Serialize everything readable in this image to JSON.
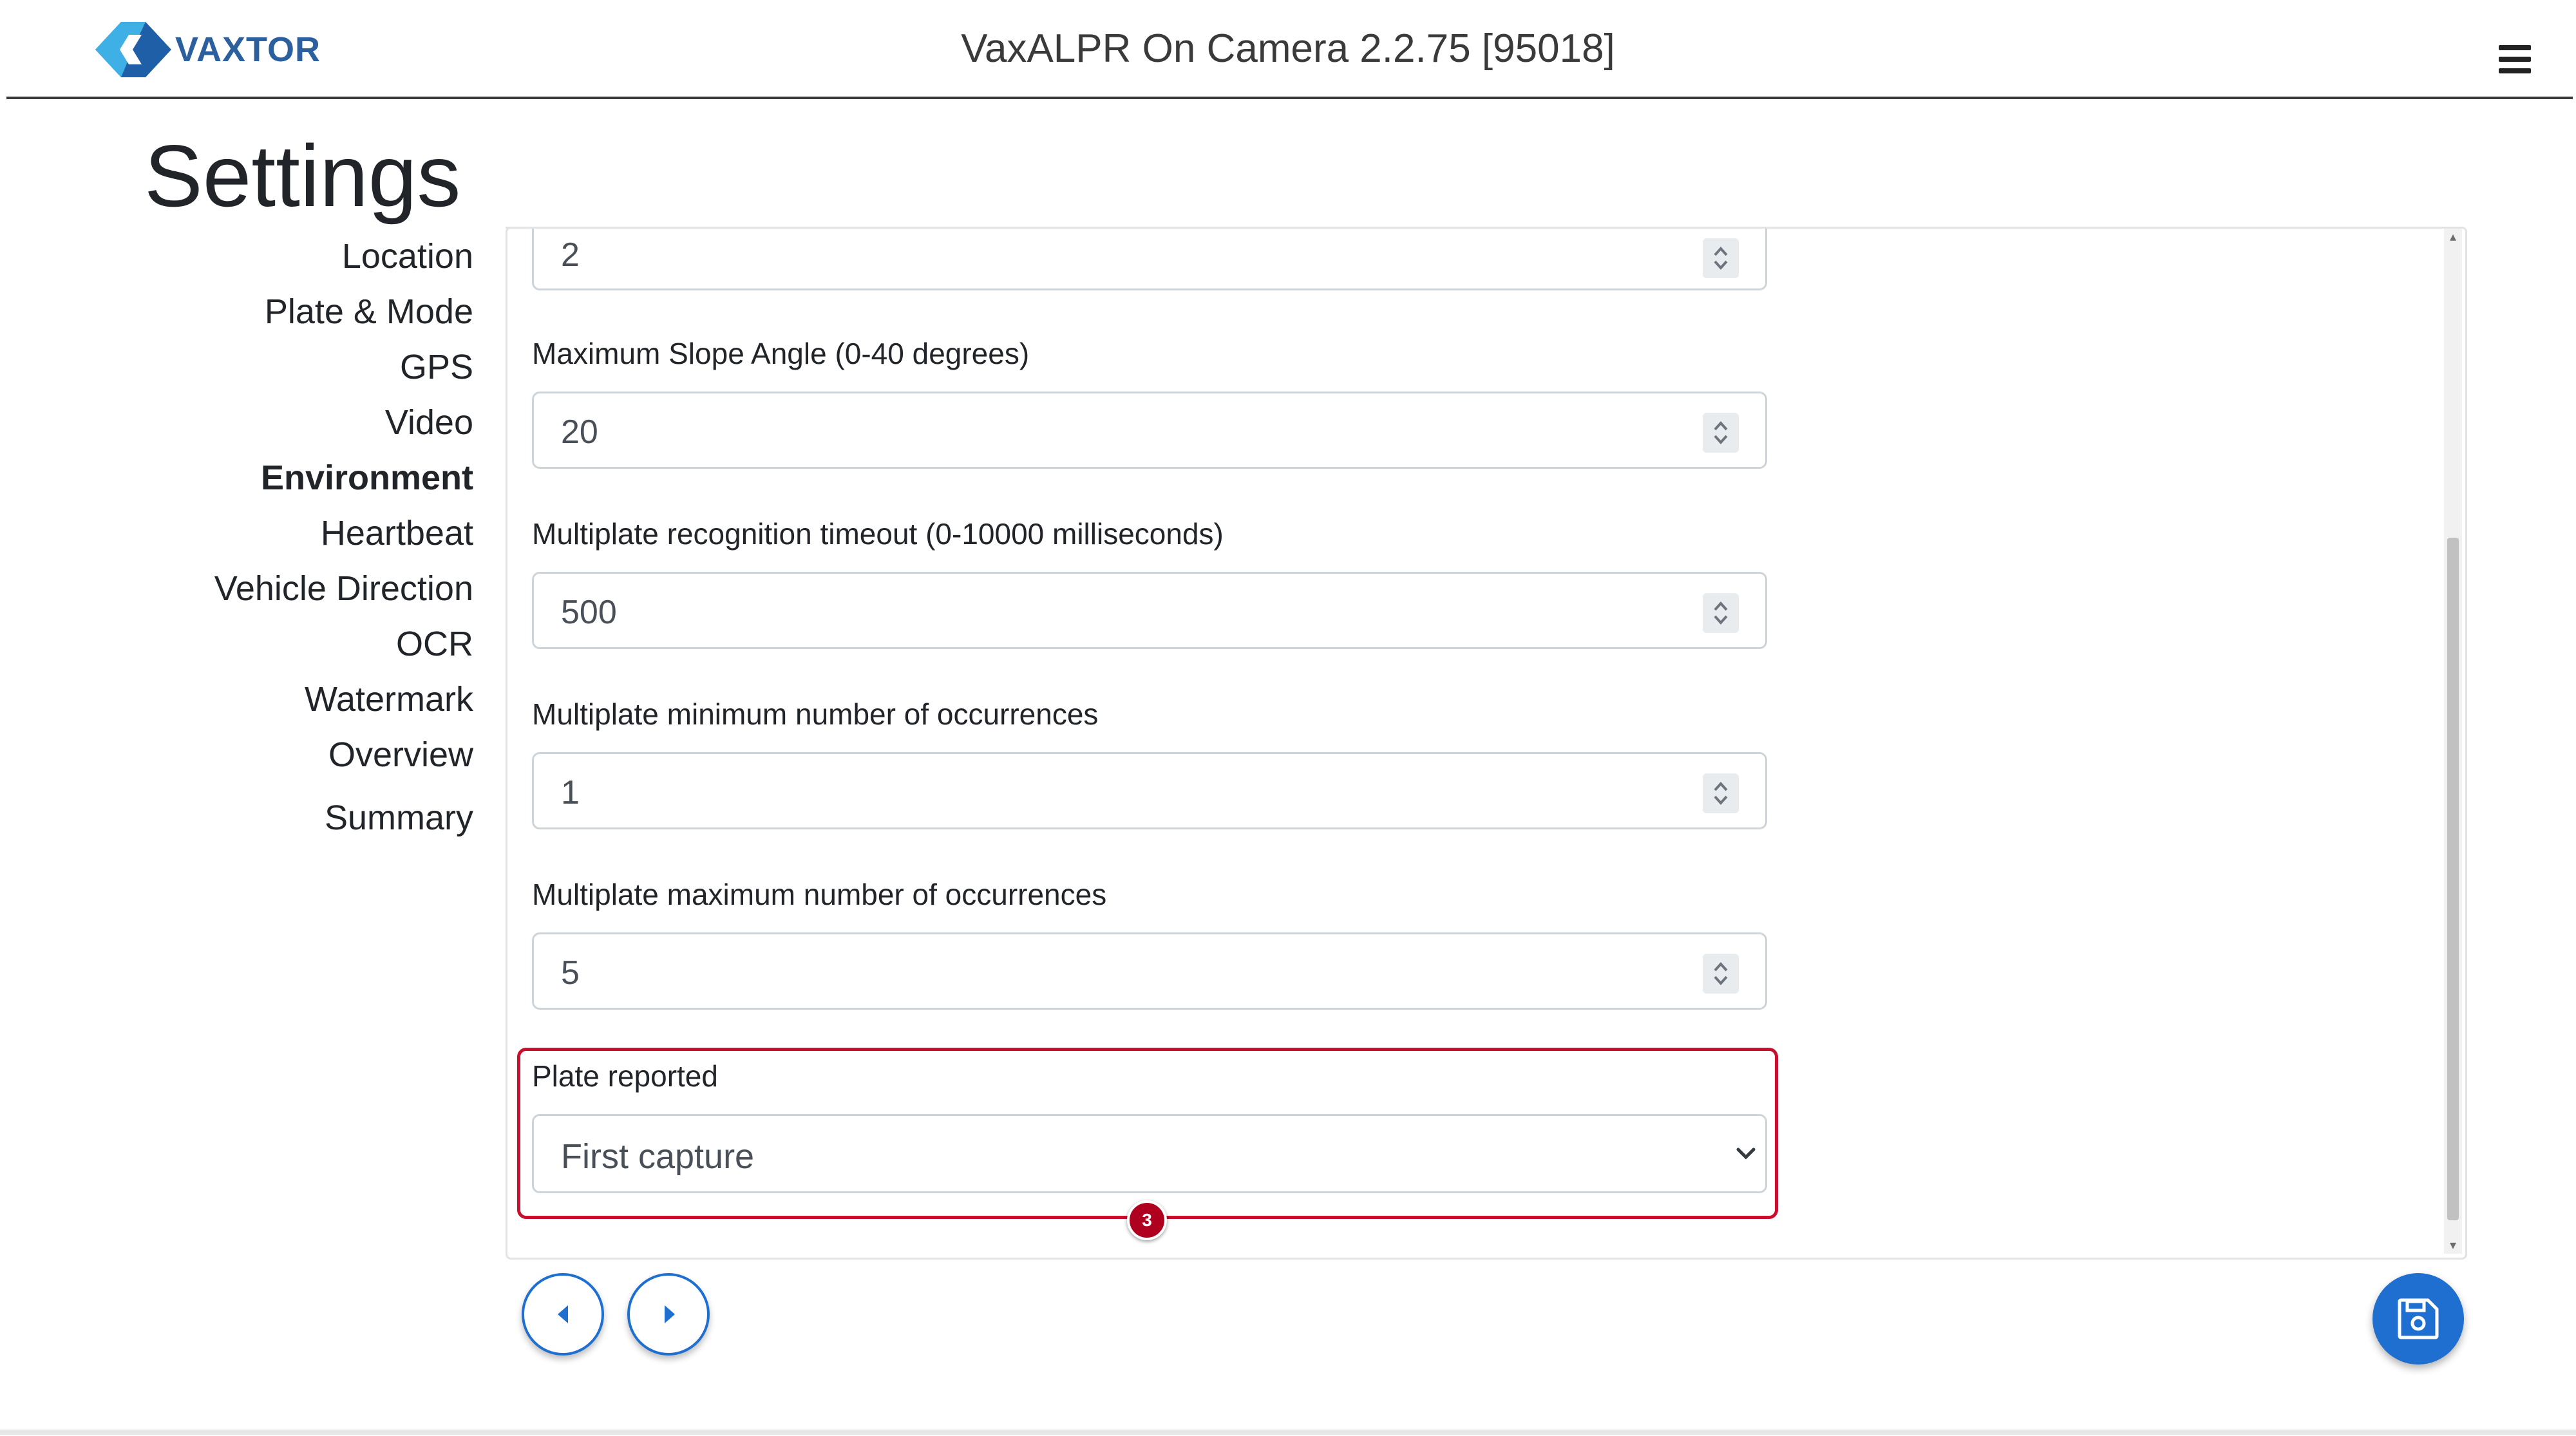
{
  "header": {
    "logo_text": "VAXTOR",
    "app_title": "VaxALPR On Camera  2.2.75 [95018]",
    "brand_colors": {
      "logo_dark": "#1f5fa8",
      "logo_light": "#3fb0e6"
    }
  },
  "page": {
    "title": "Settings"
  },
  "sidebar": {
    "items": [
      {
        "label": "Location"
      },
      {
        "label": "Plate & Mode"
      },
      {
        "label": "GPS"
      },
      {
        "label": "Video"
      },
      {
        "label": "Environment",
        "active": true
      },
      {
        "label": "Heartbeat"
      },
      {
        "label": "Vehicle Direction"
      },
      {
        "label": "OCR"
      },
      {
        "label": "Watermark"
      },
      {
        "label": "Overview"
      },
      {
        "label": "Summary"
      }
    ]
  },
  "form": {
    "partial_field": {
      "value": "2"
    },
    "fields": [
      {
        "label": "Maximum Slope Angle (0-40 degrees)",
        "value": "20"
      },
      {
        "label": "Multiplate recognition timeout (0-10000 milliseconds)",
        "value": "500"
      },
      {
        "label": "Multiplate minimum number of occurrences",
        "value": "1"
      },
      {
        "label": "Multiplate maximum number of occurrences",
        "value": "5"
      }
    ],
    "plate_reported": {
      "label": "Plate reported",
      "selected": "First capture"
    },
    "annotation_badge": "3"
  },
  "controls": {
    "prev_icon": "caret-left-icon",
    "next_icon": "caret-right-icon",
    "save_icon": "floppy-disk-icon",
    "accent_color": "#1f6fd1",
    "highlight_color": "#c8102e"
  }
}
